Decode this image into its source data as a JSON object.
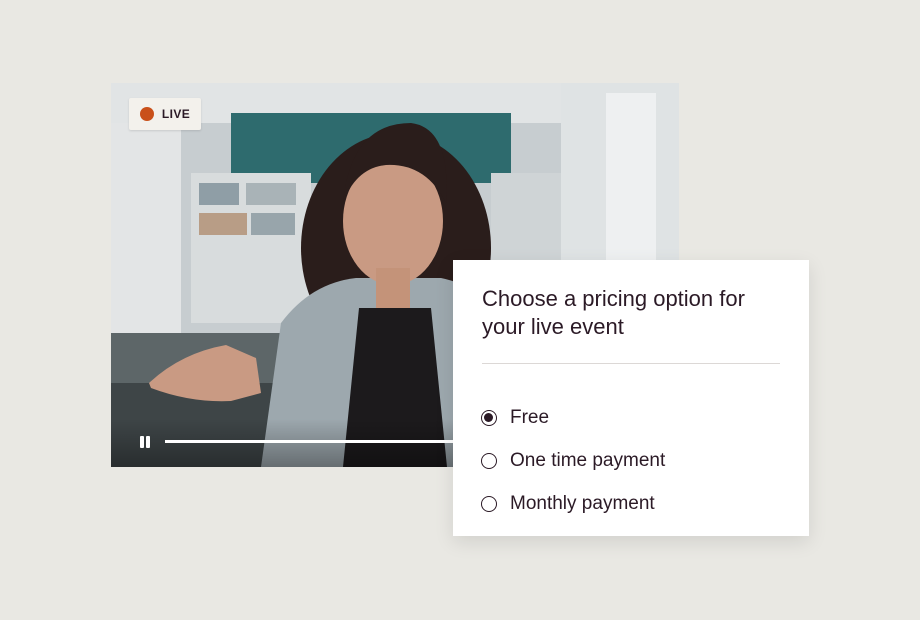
{
  "video": {
    "live_label": "LIVE",
    "progress": 0.62,
    "colors": {
      "live_dot": "#c9501a",
      "badge_bg": "#f3f1ec"
    }
  },
  "pricing": {
    "title": "Choose a pricing option for your live event",
    "options": [
      {
        "label": "Free",
        "selected": true
      },
      {
        "label": "One time payment",
        "selected": false
      },
      {
        "label": "Monthly payment",
        "selected": false
      }
    ]
  },
  "colors": {
    "background": "#e9e8e3",
    "text": "#2b1a26",
    "card": "#ffffff"
  }
}
